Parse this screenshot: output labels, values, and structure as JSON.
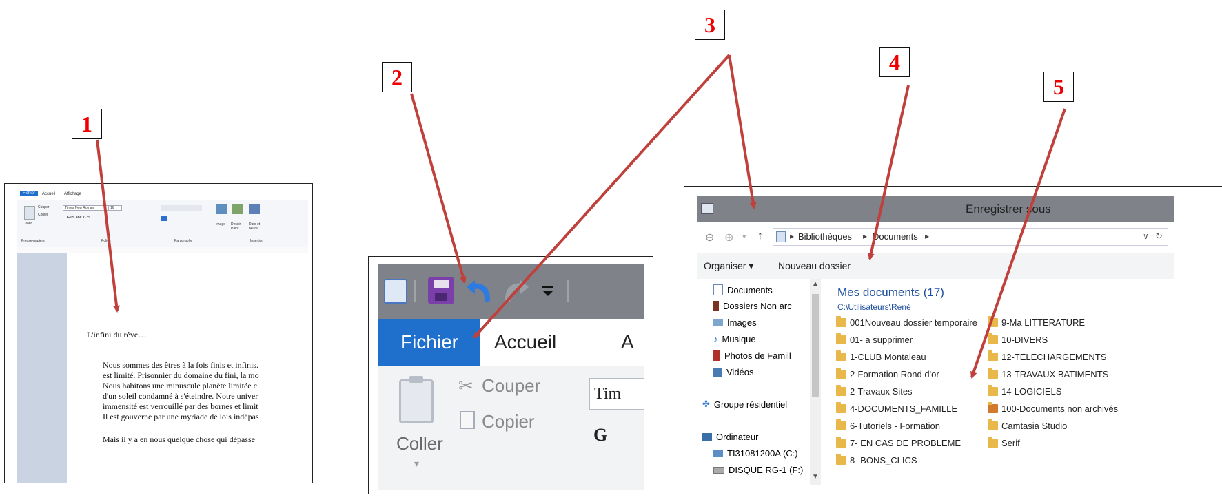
{
  "callouts": [
    "1",
    "2",
    "3",
    "4",
    "5"
  ],
  "panel1": {
    "tabs": [
      "Fichier",
      "Accueil",
      "Affichage"
    ],
    "clipboard": {
      "coller": "Coller",
      "couper": "Couper",
      "copier": "Copier",
      "group": "Presse-papiers"
    },
    "font": {
      "name": "Times New Roman",
      "size": "16",
      "group": "Police"
    },
    "paragraph_group": "Paragraphe",
    "insert": {
      "image": "Image",
      "dessin": "Dessin Paint",
      "date": "Date et heure",
      "group": "Insertion"
    },
    "document": {
      "title": "L'infini du rêve….",
      "lines": [
        "Nous sommes des êtres à la fois finis et infinis.",
        "est limité. Prisonnier du domaine du fini, la mo",
        "Nous habitons une minuscule planète limitée c",
        "d'un soleil condamné à s'éteindre. Notre univer",
        "immensité est verrouillé par des bornes et limit",
        "Il est gouverné par une myriade de lois indépas"
      ],
      "last_line": "Mais il y a en nous quelque chose qui dépasse"
    }
  },
  "panel2": {
    "tabs": {
      "fichier": "Fichier",
      "accueil": "Accueil",
      "a": "A"
    },
    "couper": "Couper",
    "copier": "Copier",
    "coller": "Coller",
    "font_partial": "Tim",
    "bold": "G"
  },
  "panel3": {
    "title": "Enregistrer sous",
    "breadcrumb": [
      "Bibliothèques",
      "Documents"
    ],
    "toolbar": {
      "organiser": "Organiser ▾",
      "nouveau": "Nouveau dossier"
    },
    "nav": {
      "documents": "Documents",
      "dossiers": "Dossiers Non arc",
      "images": "Images",
      "musique": "Musique",
      "photos": "Photos de Famill",
      "videos": "Vidéos",
      "groupe": "Groupe résidentiel",
      "ordinateur": "Ordinateur",
      "drive_c": "TI31081200A (C:)",
      "drive_f": "DISQUE RG-1 (F:)"
    },
    "heading": "Mes documents (17)",
    "path": "C:\\Utilisateurs\\René",
    "folders_left": [
      "001Nouveau dossier temporaire",
      "01- a supprimer",
      "1-CLUB Montaleau",
      "2-Formation  Rond d'or",
      "2-Travaux Sites",
      "4-DOCUMENTS_FAMILLE",
      "6-Tutoriels - Formation",
      "7- EN CAS DE PROBLEME",
      "8- BONS_CLICS"
    ],
    "folders_right": [
      "9-Ma LITTERATURE",
      "10-DIVERS",
      "12-TELECHARGEMENTS",
      "13-TRAVAUX BATIMENTS",
      "14-LOGICIELS",
      "100-Documents non archivés",
      "Camtasia Studio",
      "Serif"
    ]
  },
  "colors": {
    "accent": "#1f6fcc",
    "titlebar": "#7f8289",
    "arrow": "#c0403c",
    "callout": "#e00000"
  }
}
